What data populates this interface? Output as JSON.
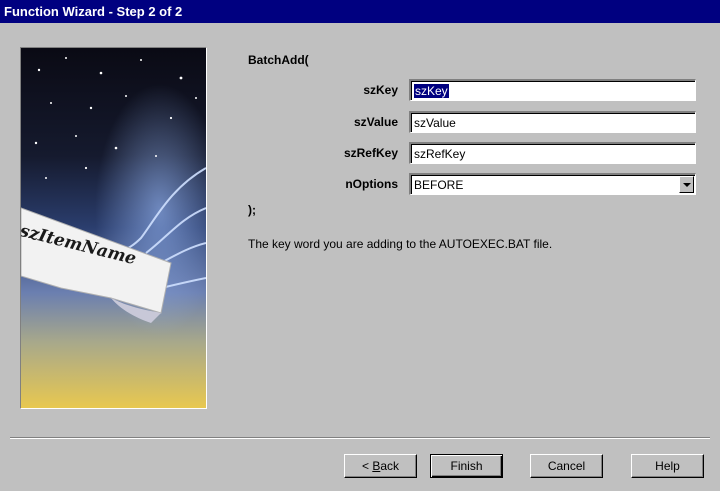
{
  "window": {
    "title": "Function Wizard - Step 2 of 2"
  },
  "art": {
    "banner_text": "szItemName"
  },
  "function": {
    "name": "BatchAdd(",
    "close": ");",
    "description": "The key word you are adding to the AUTOEXEC.BAT file."
  },
  "params": [
    {
      "label": "szKey",
      "value": "szKey",
      "selected": true
    },
    {
      "label": "szValue",
      "value": "szValue"
    },
    {
      "label": "szRefKey",
      "value": "szRefKey"
    },
    {
      "label": "nOptions",
      "value": "BEFORE",
      "type": "select"
    }
  ],
  "buttons": {
    "back_prefix": "< ",
    "back_accel": "B",
    "back_rest": "ack",
    "finish": "Finish",
    "cancel": "Cancel",
    "help": "Help"
  }
}
